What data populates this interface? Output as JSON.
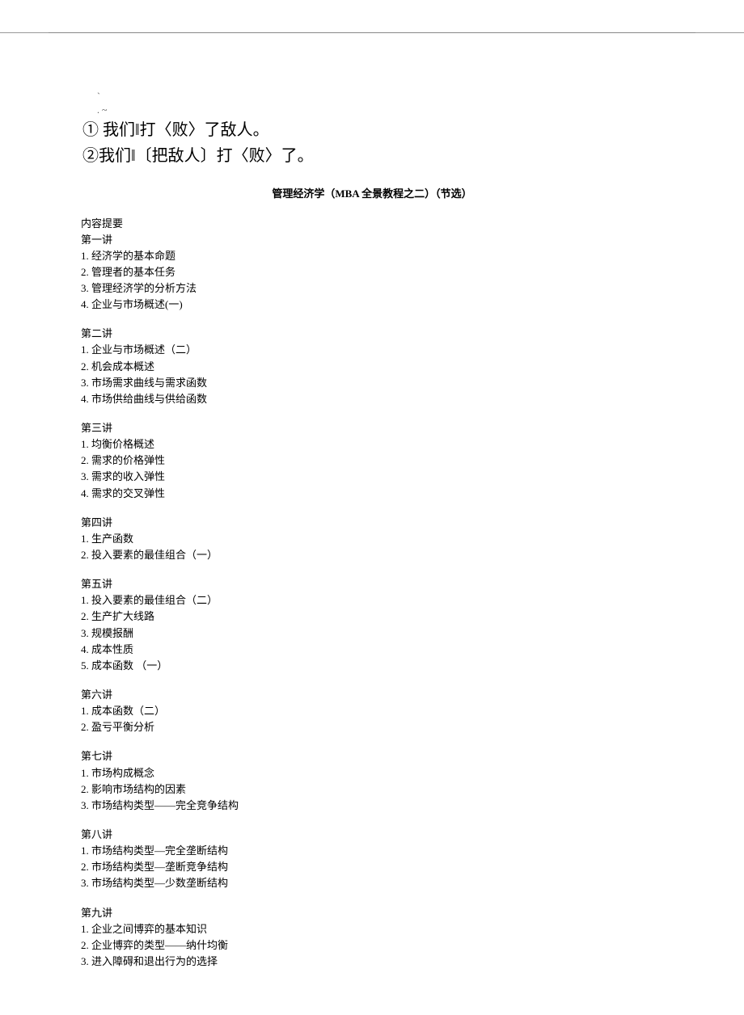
{
  "marks": {
    "line1": "`",
    "line2": ".  ~"
  },
  "examples": {
    "line1": "① 我们‖打〈败〉了敌人。",
    "line2": "②我们‖〔把敌人〕打〈败〉了。"
  },
  "document_title": "管理经济学（MBA 全景教程之二）（节选）",
  "toc_label": "内容提要",
  "lectures": [
    {
      "title": "第一讲",
      "items": [
        "1. 经济学的基本命题",
        "2. 管理者的基本任务",
        "3. 管理经济学的分析方法",
        "4. 企业与市场概述(一)"
      ]
    },
    {
      "title": "第二讲",
      "items": [
        "1. 企业与市场概述（二）",
        "2. 机会成本概述",
        "3. 市场需求曲线与需求函数",
        "4. 市场供给曲线与供给函数"
      ]
    },
    {
      "title": "第三讲",
      "items": [
        "1. 均衡价格概述",
        "2. 需求的价格弹性",
        "3. 需求的收入弹性",
        "4. 需求的交叉弹性"
      ]
    },
    {
      "title": "第四讲",
      "items": [
        "1. 生产函数",
        "2. 投入要素的最佳组合（一）"
      ]
    },
    {
      "title": "第五讲",
      "items": [
        "1. 投入要素的最佳组合（二）",
        "2. 生产扩大线路",
        "3. 规模报酬",
        "4. 成本性质",
        "5. 成本函数 （一）"
      ]
    },
    {
      "title": "第六讲",
      "items": [
        "1. 成本函数（二）",
        "2. 盈亏平衡分析"
      ]
    },
    {
      "title": "第七讲",
      "items": [
        "1. 市场构成概念",
        "2. 影响市场结构的因素",
        "3. 市场结构类型——完全竞争结构"
      ]
    },
    {
      "title": "第八讲",
      "items": [
        "1. 市场结构类型—完全垄断结构",
        "2. 市场结构类型—垄断竞争结构",
        "3. 市场结构类型—少数垄断结构"
      ]
    },
    {
      "title": "第九讲",
      "items": [
        "1. 企业之间博弈的基本知识",
        "2. 企业博弈的类型——纳什均衡",
        "3. 进入障碍和退出行为的选择"
      ]
    }
  ]
}
